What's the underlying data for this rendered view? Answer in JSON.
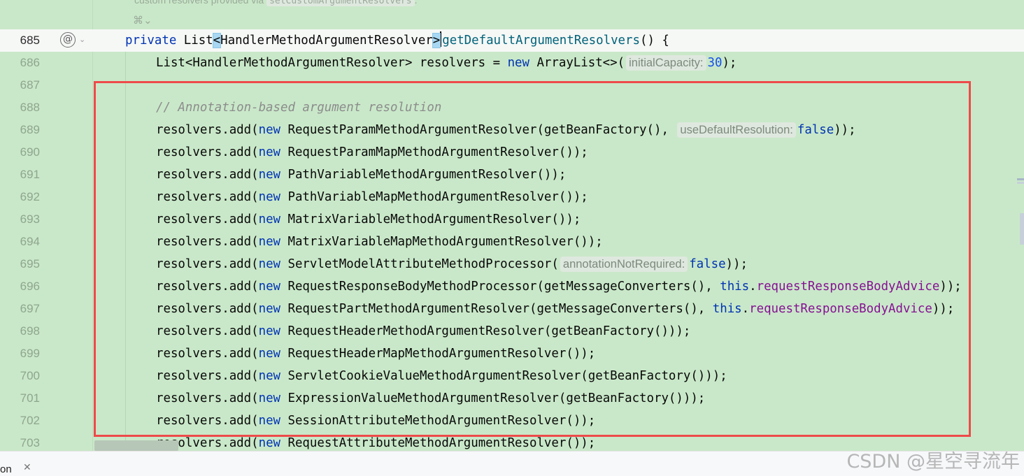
{
  "doc_comment": {
    "text": "custom resolvers provided via ",
    "code": "setCustomArgumentResolvers",
    "suffix": ".",
    "toggle": "⌘"
  },
  "lines": [
    {
      "n": "685",
      "parts": [
        [
          "kw",
          "private "
        ],
        [
          "",
          "List"
        ],
        [
          "brace",
          "<"
        ],
        [
          "",
          "HandlerMethodArgumentResolver"
        ],
        [
          "brace",
          ">"
        ],
        [
          "",
          ""
        ],
        [
          "caret",
          ""
        ],
        [
          "fn",
          "getDefaultArgumentResolvers"
        ],
        [
          "",
          "() {"
        ]
      ]
    },
    {
      "n": "686",
      "parts": [
        [
          "",
          "List<HandlerMethodArgumentResolver> resolvers = "
        ],
        [
          "kw",
          "new"
        ],
        [
          "",
          " ArrayList<>("
        ],
        [
          "hint",
          "initialCapacity:"
        ],
        [
          "num",
          "30"
        ],
        [
          "",
          ");"
        ]
      ]
    },
    {
      "n": "687",
      "parts": []
    },
    {
      "n": "688",
      "parts": [
        [
          "cmt",
          "// Annotation-based argument resolution"
        ]
      ]
    },
    {
      "n": "689",
      "parts": [
        [
          "",
          "resolvers.add("
        ],
        [
          "kw",
          "new"
        ],
        [
          "",
          " RequestParamMethodArgumentResolver(getBeanFactory(), "
        ],
        [
          "hint",
          "useDefaultResolution:"
        ],
        [
          "kw",
          "false"
        ],
        [
          "",
          "));"
        ]
      ]
    },
    {
      "n": "690",
      "parts": [
        [
          "",
          "resolvers.add("
        ],
        [
          "kw",
          "new"
        ],
        [
          "",
          " RequestParamMapMethodArgumentResolver());"
        ]
      ]
    },
    {
      "n": "691",
      "parts": [
        [
          "",
          "resolvers.add("
        ],
        [
          "kw",
          "new"
        ],
        [
          "",
          " PathVariableMethodArgumentResolver());"
        ]
      ]
    },
    {
      "n": "692",
      "parts": [
        [
          "",
          "resolvers.add("
        ],
        [
          "kw",
          "new"
        ],
        [
          "",
          " PathVariableMapMethodArgumentResolver());"
        ]
      ]
    },
    {
      "n": "693",
      "parts": [
        [
          "",
          "resolvers.add("
        ],
        [
          "kw",
          "new"
        ],
        [
          "",
          " MatrixVariableMethodArgumentResolver());"
        ]
      ]
    },
    {
      "n": "694",
      "parts": [
        [
          "",
          "resolvers.add("
        ],
        [
          "kw",
          "new"
        ],
        [
          "",
          " MatrixVariableMapMethodArgumentResolver());"
        ]
      ]
    },
    {
      "n": "695",
      "parts": [
        [
          "",
          "resolvers.add("
        ],
        [
          "kw",
          "new"
        ],
        [
          "",
          " ServletModelAttributeMethodProcessor("
        ],
        [
          "hint",
          "annotationNotRequired:"
        ],
        [
          "kw",
          "false"
        ],
        [
          "",
          "));"
        ]
      ]
    },
    {
      "n": "696",
      "parts": [
        [
          "",
          "resolvers.add("
        ],
        [
          "kw",
          "new"
        ],
        [
          "",
          " RequestResponseBodyMethodProcessor(getMessageConverters(), "
        ],
        [
          "kw",
          "this"
        ],
        [
          "",
          "."
        ],
        [
          "fld",
          "requestResponseBodyAdvice"
        ],
        [
          "",
          "));"
        ]
      ]
    },
    {
      "n": "697",
      "parts": [
        [
          "",
          "resolvers.add("
        ],
        [
          "kw",
          "new"
        ],
        [
          "",
          " RequestPartMethodArgumentResolver(getMessageConverters(), "
        ],
        [
          "kw",
          "this"
        ],
        [
          "",
          "."
        ],
        [
          "fld",
          "requestResponseBodyAdvice"
        ],
        [
          "",
          "));"
        ]
      ]
    },
    {
      "n": "698",
      "parts": [
        [
          "",
          "resolvers.add("
        ],
        [
          "kw",
          "new"
        ],
        [
          "",
          " RequestHeaderMethodArgumentResolver(getBeanFactory()));"
        ]
      ]
    },
    {
      "n": "699",
      "parts": [
        [
          "",
          "resolvers.add("
        ],
        [
          "kw",
          "new"
        ],
        [
          "",
          " RequestHeaderMapMethodArgumentResolver());"
        ]
      ]
    },
    {
      "n": "700",
      "parts": [
        [
          "",
          "resolvers.add("
        ],
        [
          "kw",
          "new"
        ],
        [
          "",
          " ServletCookieValueMethodArgumentResolver(getBeanFactory()));"
        ]
      ]
    },
    {
      "n": "701",
      "parts": [
        [
          "",
          "resolvers.add("
        ],
        [
          "kw",
          "new"
        ],
        [
          "",
          " ExpressionValueMethodArgumentResolver(getBeanFactory()));"
        ]
      ]
    },
    {
      "n": "702",
      "parts": [
        [
          "",
          "resolvers.add("
        ],
        [
          "kw",
          "new"
        ],
        [
          "",
          " SessionAttributeMethodArgumentResolver());"
        ]
      ]
    },
    {
      "n": "703",
      "parts": [
        [
          "",
          "resolvers.add("
        ],
        [
          "kw",
          "new"
        ],
        [
          "",
          " RequestAttributeMethodArgumentResolver());"
        ]
      ]
    }
  ],
  "gutter": {
    "at_symbol": "@",
    "chevron": "⌄"
  },
  "bottom": {
    "tab_label": "on",
    "close": "✕"
  },
  "watermark": "CSDN @星空寻流年",
  "colors": {
    "editor_bg": "#c9e8c9",
    "current_line_bg": "#f6f8f6",
    "highlight_box": "#ee4a4a",
    "keyword": "#0033b3",
    "method": "#00627a",
    "field": "#871094",
    "number": "#1750eb"
  }
}
